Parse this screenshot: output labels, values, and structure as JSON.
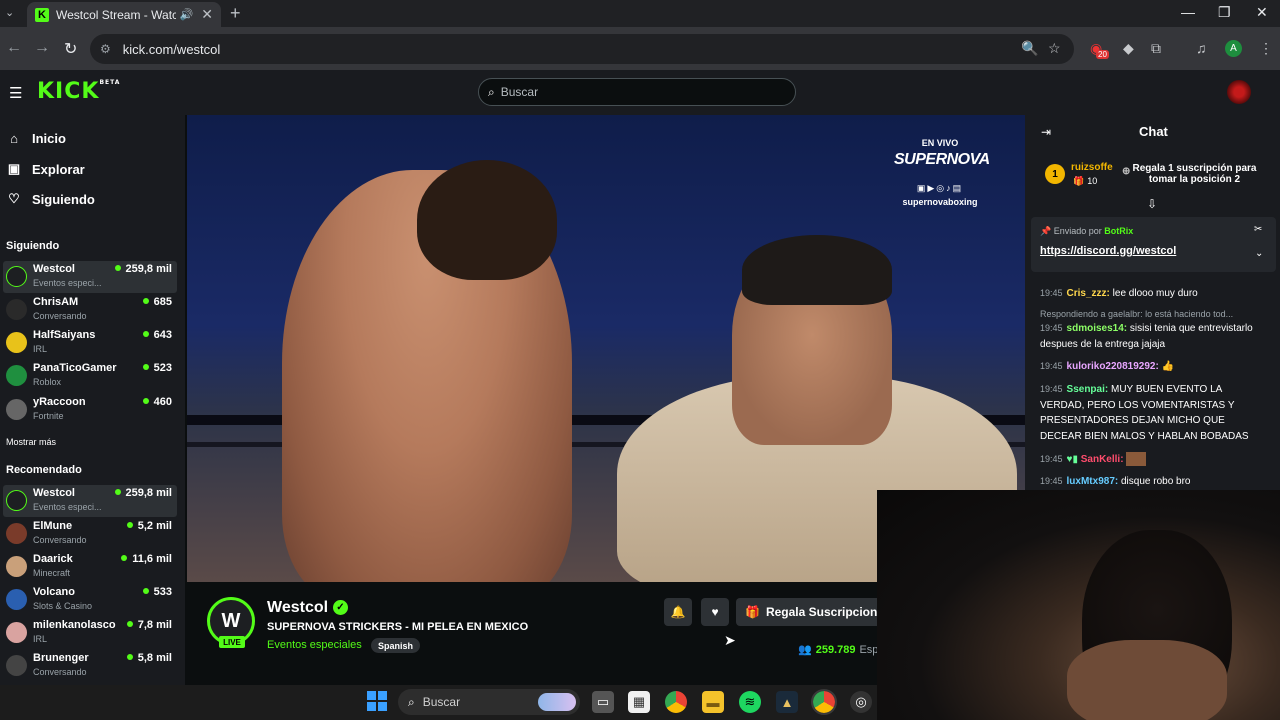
{
  "browser": {
    "tab_title": "Westcol Stream - Watch Live",
    "url": "kick.com/westcol",
    "extension_badge": "20",
    "profile_initial": "A"
  },
  "header": {
    "logo": "KICK",
    "logo_badge": "BETA",
    "search_placeholder": "Buscar"
  },
  "nav": [
    {
      "label": "Inicio",
      "icon": "home-icon"
    },
    {
      "label": "Explorar",
      "icon": "browse-icon"
    },
    {
      "label": "Siguiendo",
      "icon": "heart-icon"
    }
  ],
  "following": {
    "title": "Siguiendo",
    "channels": [
      {
        "name": "Westcol",
        "category": "Eventos especi...",
        "viewers": "259,8 mil"
      },
      {
        "name": "ChrisAM",
        "category": "Conversando",
        "viewers": "685"
      },
      {
        "name": "HalfSaiyans",
        "category": "IRL",
        "viewers": "643"
      },
      {
        "name": "PanaTicoGamer",
        "category": "Roblox",
        "viewers": "523"
      },
      {
        "name": "yRaccoon",
        "category": "Fortnite",
        "viewers": "460"
      }
    ],
    "show_more": "Mostrar más"
  },
  "recommended": {
    "title": "Recomendado",
    "channels": [
      {
        "name": "Westcol",
        "category": "Eventos especi...",
        "viewers": "259,8 mil"
      },
      {
        "name": "ElMune",
        "category": "Conversando",
        "viewers": "5,2 mil"
      },
      {
        "name": "Daarick",
        "category": "Minecraft",
        "viewers": "11,6 mil"
      },
      {
        "name": "Volcano",
        "category": "Slots & Casino",
        "viewers": "533"
      },
      {
        "name": "milenkanolasco",
        "category": "IRL",
        "viewers": "7,8 mil"
      },
      {
        "name": "Brunenger",
        "category": "Conversando",
        "viewers": "5,8 mil"
      }
    ]
  },
  "video_overlay": {
    "live": "EN VIVO",
    "brand": "SUPERNOVA",
    "handle": "supernovaboxing"
  },
  "stream": {
    "channel": "Westcol",
    "title": "SUPERNOVA STRICKERS - MI PELEA EN MEXICO",
    "category": "Eventos especiales",
    "language": "Spanish",
    "live_badge": "LIVE",
    "gift_button": "Regala Suscripciones",
    "viewers": "259.789",
    "viewers_suffix": "Esp"
  },
  "chat": {
    "title": "Chat",
    "leader": {
      "rank": "1",
      "name": "ruizsoffe",
      "gifts": "10"
    },
    "gift_prompt": "Regala 1 suscripción para tomar la posición 2",
    "pinned": {
      "sent_by_label": "Enviado por",
      "sender": "BotRix",
      "link": "https://discord.gg/westcol"
    },
    "reply_context": "Respondiendo a gaelalbr: lo está haciendo tod...",
    "messages": [
      {
        "time": "19:45",
        "user": "Cris_zzz:",
        "text": "lee dlooo muy duro",
        "color": "#ffd84d"
      },
      {
        "time": "19:45",
        "user": "sdmoises14:",
        "text": "sisisi tenia que entrevistarlo despues de la entrega jajaja",
        "color": "#8cff66"
      },
      {
        "time": "19:45",
        "user": "kuloriko220819292:",
        "text": "",
        "color": "#e8a6ff"
      },
      {
        "time": "19:45",
        "user": "Ssenpai:",
        "text": "MUY BUEN EVENTO LA VERDAD, PERO LOS VOMENTARISTAS Y PRESENTADORES DEJAN MICHO QUE DECEAR BIEN MALOS Y HABLAN BOBADAS",
        "color": "#66ff99"
      },
      {
        "time": "19:45",
        "user": "SanKelli:",
        "text": "",
        "color": "#ff4d6d"
      },
      {
        "time": "19:45",
        "user": "luxMtx987:",
        "text": "disque robo bro",
        "color": "#66ccff"
      }
    ]
  },
  "taskbar": {
    "search_placeholder": "Buscar"
  },
  "colors": {
    "kick_green": "#53fc18",
    "background": "#0b0e0f",
    "panel": "#191b1f"
  }
}
